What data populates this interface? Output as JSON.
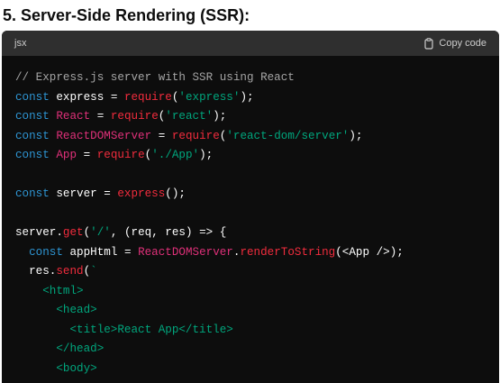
{
  "heading": "5. Server-Side Rendering (SSR):",
  "code_block": {
    "language": "jsx",
    "copy_label": "Copy code",
    "copy_icon": "clipboard-icon",
    "colors": {
      "header_bg": "#2f2f2f",
      "body_bg": "#0d0d0d",
      "comment": "#a5a5a5",
      "keyword": "#2e95d3",
      "variable": "#df3079",
      "function": "#f22c3d",
      "string": "#00a67d"
    },
    "lines": [
      [
        {
          "t": "comment",
          "v": "// Express.js server with SSR using React"
        }
      ],
      [
        {
          "t": "keyword",
          "v": "const"
        },
        {
          "t": "plain",
          "v": " express = "
        },
        {
          "t": "func",
          "v": "require"
        },
        {
          "t": "plain",
          "v": "("
        },
        {
          "t": "string",
          "v": "'express'"
        },
        {
          "t": "plain",
          "v": ");"
        }
      ],
      [
        {
          "t": "keyword",
          "v": "const"
        },
        {
          "t": "plain",
          "v": " "
        },
        {
          "t": "var",
          "v": "React"
        },
        {
          "t": "plain",
          "v": " = "
        },
        {
          "t": "func",
          "v": "require"
        },
        {
          "t": "plain",
          "v": "("
        },
        {
          "t": "string",
          "v": "'react'"
        },
        {
          "t": "plain",
          "v": ");"
        }
      ],
      [
        {
          "t": "keyword",
          "v": "const"
        },
        {
          "t": "plain",
          "v": " "
        },
        {
          "t": "var",
          "v": "ReactDOMServer"
        },
        {
          "t": "plain",
          "v": " = "
        },
        {
          "t": "func",
          "v": "require"
        },
        {
          "t": "plain",
          "v": "("
        },
        {
          "t": "string",
          "v": "'react-dom/server'"
        },
        {
          "t": "plain",
          "v": ");"
        }
      ],
      [
        {
          "t": "keyword",
          "v": "const"
        },
        {
          "t": "plain",
          "v": " "
        },
        {
          "t": "var",
          "v": "App"
        },
        {
          "t": "plain",
          "v": " = "
        },
        {
          "t": "func",
          "v": "require"
        },
        {
          "t": "plain",
          "v": "("
        },
        {
          "t": "string",
          "v": "'./App'"
        },
        {
          "t": "plain",
          "v": ");"
        }
      ],
      [],
      [
        {
          "t": "keyword",
          "v": "const"
        },
        {
          "t": "plain",
          "v": " server = "
        },
        {
          "t": "func",
          "v": "express"
        },
        {
          "t": "plain",
          "v": "();"
        }
      ],
      [],
      [
        {
          "t": "plain",
          "v": "server."
        },
        {
          "t": "func",
          "v": "get"
        },
        {
          "t": "plain",
          "v": "("
        },
        {
          "t": "string",
          "v": "'/'"
        },
        {
          "t": "plain",
          "v": ", (req, res) => {"
        }
      ],
      [
        {
          "t": "plain",
          "v": "  "
        },
        {
          "t": "keyword",
          "v": "const"
        },
        {
          "t": "plain",
          "v": " appHtml = "
        },
        {
          "t": "var",
          "v": "ReactDOMServer"
        },
        {
          "t": "plain",
          "v": "."
        },
        {
          "t": "func",
          "v": "renderToString"
        },
        {
          "t": "plain",
          "v": "(<App />);"
        }
      ],
      [
        {
          "t": "plain",
          "v": "  res."
        },
        {
          "t": "func",
          "v": "send"
        },
        {
          "t": "plain",
          "v": "("
        },
        {
          "t": "string",
          "v": "`"
        }
      ],
      [
        {
          "t": "string",
          "v": "    <html>"
        }
      ],
      [
        {
          "t": "string",
          "v": "      <head>"
        }
      ],
      [
        {
          "t": "string",
          "v": "        <title>React App</title>"
        }
      ],
      [
        {
          "t": "string",
          "v": "      </head>"
        }
      ],
      [
        {
          "t": "string",
          "v": "      <body>"
        }
      ]
    ]
  }
}
